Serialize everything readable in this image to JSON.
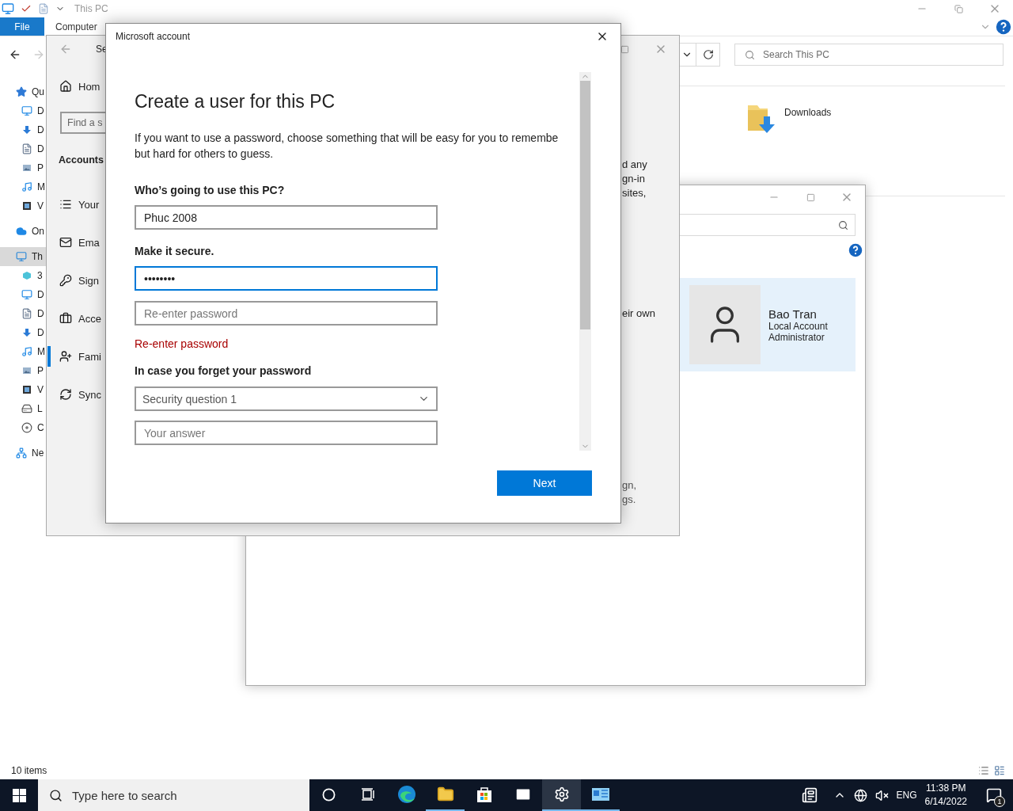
{
  "explorer": {
    "title": "This PC",
    "ribbon_tabs": [
      {
        "label": "File",
        "selected": true
      },
      {
        "label": "Computer",
        "selected": false
      }
    ],
    "search": {
      "placeholder": "Search This PC"
    },
    "nav": [
      {
        "label": "Qu",
        "kind": "quick",
        "selected": false,
        "children": [
          {
            "label": "D",
            "kind": "desktop",
            "selected": false
          },
          {
            "label": "D",
            "kind": "downloads",
            "selected": false
          },
          {
            "label": "D",
            "kind": "documents",
            "selected": false
          },
          {
            "label": "P",
            "kind": "pictures",
            "selected": false
          },
          {
            "label": "M",
            "kind": "music",
            "selected": false
          },
          {
            "label": "V",
            "kind": "videos",
            "selected": false
          }
        ]
      },
      {
        "label": "On",
        "kind": "onedrive",
        "selected": false
      },
      {
        "label": "Th",
        "kind": "pc",
        "selected": true,
        "children": [
          {
            "label": "3",
            "kind": "objects",
            "selected": false
          },
          {
            "label": "D",
            "kind": "desktop",
            "selected": false
          },
          {
            "label": "D",
            "kind": "documents",
            "selected": false
          },
          {
            "label": "D",
            "kind": "downloads",
            "selected": false
          },
          {
            "label": "M",
            "kind": "music",
            "selected": false
          },
          {
            "label": "P",
            "kind": "pictures",
            "selected": false
          },
          {
            "label": "V",
            "kind": "videos",
            "selected": false
          },
          {
            "label": "L",
            "kind": "drive",
            "selected": false
          },
          {
            "label": "C",
            "kind": "disc",
            "selected": false
          }
        ]
      },
      {
        "label": "Ne",
        "kind": "network",
        "selected": false
      }
    ],
    "folders": [
      {
        "label": "Downloads"
      }
    ],
    "status": "10 items"
  },
  "user_accounts": {
    "user": {
      "name": "Bao Tran",
      "type": "Local Account",
      "role": "Administrator"
    }
  },
  "settings": {
    "title": "Se",
    "home": "Hom",
    "search": {
      "placeholder": "Find a s"
    },
    "section": "Accounts",
    "nav": [
      {
        "label": "Your",
        "kind": "info",
        "selected": false
      },
      {
        "label": "Ema",
        "kind": "mail",
        "selected": false
      },
      {
        "label": "Sign",
        "kind": "key",
        "selected": false
      },
      {
        "label": "Acce",
        "kind": "work",
        "selected": false
      },
      {
        "label": "Fami",
        "kind": "family",
        "selected": true
      },
      {
        "label": "Sync",
        "kind": "sync",
        "selected": false
      }
    ],
    "pane_text": [
      {
        "text": "d any\ngn-in\nsites,"
      },
      {
        "text": "eir own"
      },
      {
        "text": "gn,\ngs."
      }
    ]
  },
  "dialog": {
    "title": "Microsoft account",
    "heading": "Create a user for this PC",
    "intro": "If you want to use a password, choose something that will be easy for you to remembe\nbut hard for others to guess.",
    "name_label": "Who’s going to use this PC?",
    "name": {
      "value": "Phuc 2008",
      "focused": false
    },
    "secure_label": "Make it secure.",
    "password": {
      "value": "••••••••",
      "focused": true
    },
    "confirm": {
      "placeholder": "Re-enter password",
      "focused": false
    },
    "error": "Re-enter password",
    "forget_label": "In case you forget your password",
    "question": {
      "value": "Security question 1"
    },
    "answer": {
      "placeholder": "Your answer"
    },
    "next": "Next"
  },
  "taskbar": {
    "search_placeholder": "Type here to search",
    "apps": [
      {
        "kind": "cortana",
        "open": false,
        "selected": false
      },
      {
        "kind": "taskview",
        "open": false,
        "selected": false
      },
      {
        "kind": "edge",
        "open": false,
        "selected": false
      },
      {
        "kind": "explorer",
        "open": true,
        "selected": false
      },
      {
        "kind": "store",
        "open": false,
        "selected": false
      },
      {
        "kind": "mail",
        "open": false,
        "selected": false
      },
      {
        "kind": "settings",
        "open": true,
        "selected": true
      },
      {
        "kind": "control",
        "open": true,
        "selected": false
      }
    ],
    "language": "ENG",
    "time": "11:38 PM",
    "date": "6/14/2022",
    "notifications": "1"
  }
}
